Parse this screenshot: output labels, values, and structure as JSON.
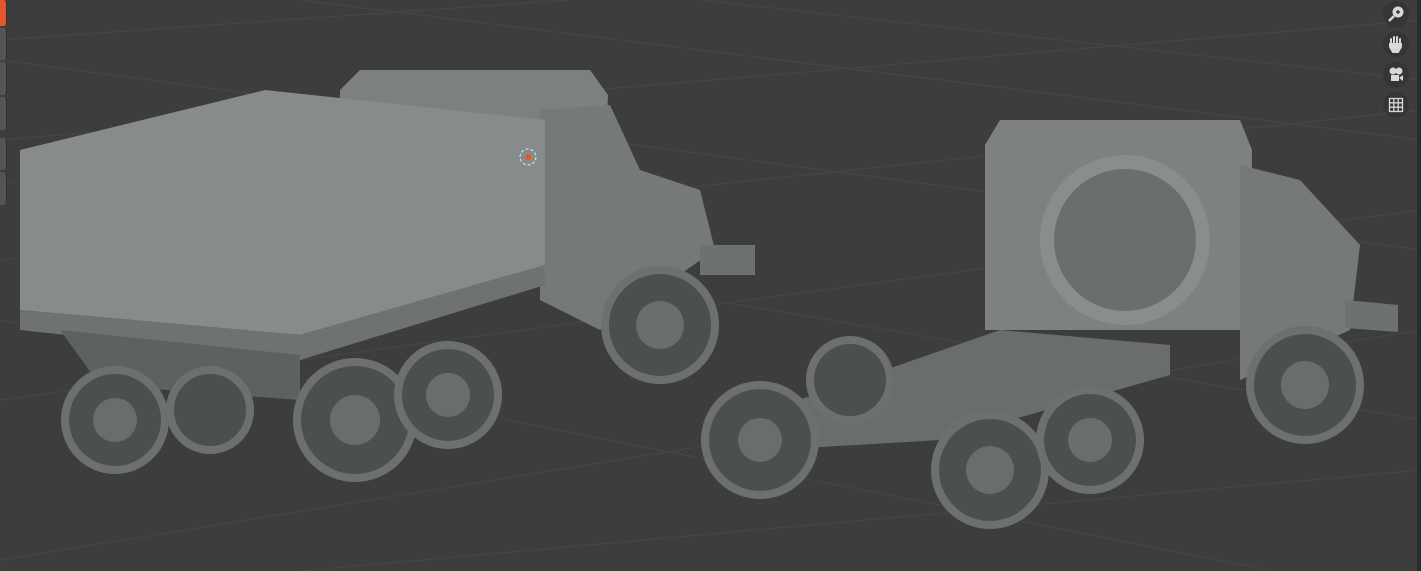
{
  "viewport": {
    "background": "#3d3d3d",
    "grid_color": "#474747",
    "model_color": "#8a8d8e",
    "active_tool_color": "#e0582b"
  },
  "navigation_gizmo": {
    "icons": [
      "zoom-icon",
      "pan-hand-icon",
      "camera-icon",
      "ortho-grid-icon"
    ]
  }
}
